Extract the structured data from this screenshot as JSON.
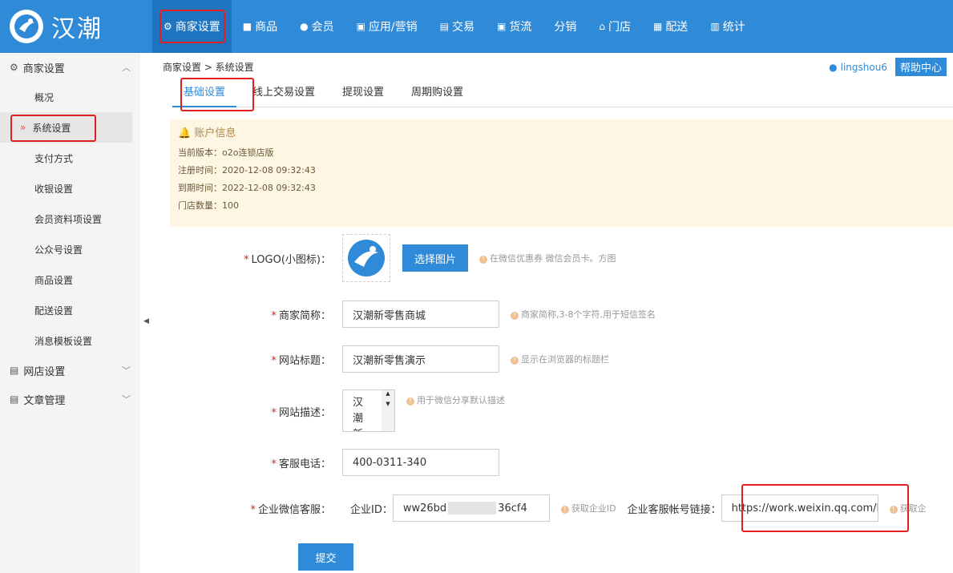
{
  "brand": {
    "name": "汉潮"
  },
  "nav": [
    "商家设置",
    "商品",
    "会员",
    "应用/营销",
    "交易",
    "货流",
    "分销",
    "门店",
    "配送",
    "统计"
  ],
  "sidebar": {
    "section1": "商家设置",
    "items": [
      "概况",
      "系统设置",
      "支付方式",
      "收银设置",
      "会员资料项设置",
      "公众号设置",
      "商品设置",
      "配送设置",
      "消息模板设置"
    ],
    "section2": "网店设置",
    "section3": "文章管理"
  },
  "breadcrumb": "商家设置 > 系统设置",
  "user": {
    "name": "lingshou6",
    "help": "帮助中心"
  },
  "tabs": [
    "基础设置",
    "线上交易设置",
    "提现设置",
    "周期购设置"
  ],
  "account": {
    "title": "账户信息",
    "version": "当前版本：o2o连锁店版",
    "registered": "注册时间：2020-12-08 09:32:43",
    "expires": "到期时间：2022-12-08 09:32:43",
    "stores": "门店数量：100"
  },
  "form": {
    "logo_label": "LOGO(小图标)：",
    "logo_button": "选择图片",
    "logo_hint": "在微信优惠券 微信会员卡。方图",
    "short_label": "商家简称：",
    "short_value": "汉潮新零售商城",
    "short_hint": "商家简称,3-8个字符,用于短信签名",
    "site_title_label": "网站标题：",
    "site_title_value": "汉潮新零售演示",
    "site_title_hint": "显示在浏览器的标题栏",
    "desc_label": "网站描述：",
    "desc_value": "汉潮新",
    "desc_hint": "用于微信分享默认描述",
    "phone_label": "客服电话：",
    "phone_value": "400-0311-340",
    "wecom_label": "企业微信客服：",
    "corp_id_label": "企业ID：",
    "corp_id_value_a": "ww26bd",
    "corp_id_value_b": "36cf4",
    "corp_id_hint": "获取企业ID",
    "account_link_label": "企业客服帐号链接：",
    "account_link_value": "https://work.weixin.qq.com/l",
    "account_link_hint": "获取企",
    "submit": "提交"
  }
}
